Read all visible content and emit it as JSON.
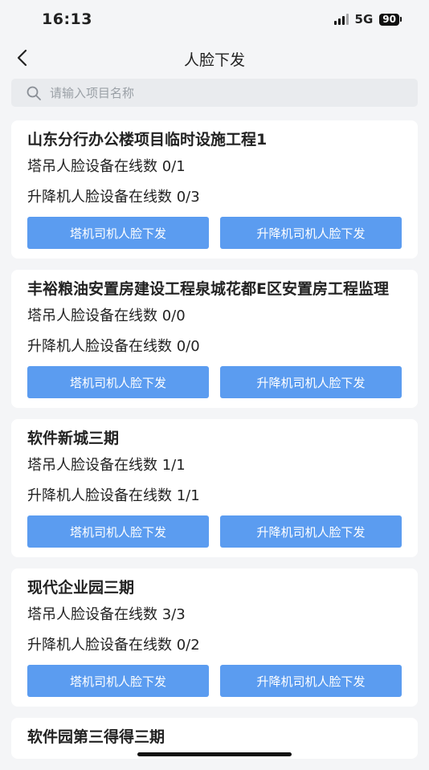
{
  "status_bar": {
    "time": "16:13",
    "network": "5G",
    "battery": "90"
  },
  "nav": {
    "title": "人脸下发",
    "back_icon": "chevron-left-icon"
  },
  "search": {
    "placeholder": "请输入项目名称",
    "value": ""
  },
  "projects": [
    {
      "name": "山东分行办公楼项目临时设施工程1",
      "tower_crane_stat": "塔吊人脸设备在线数 0/1",
      "elevator_stat": "升降机人脸设备在线数 0/3",
      "tower_button": "塔机司机人脸下发",
      "elevator_button": "升降机司机人脸下发"
    },
    {
      "name": "丰裕粮油安置房建设工程泉城花都E区安置房工程监理",
      "tower_crane_stat": "塔吊人脸设备在线数 0/0",
      "elevator_stat": "升降机人脸设备在线数 0/0",
      "tower_button": "塔机司机人脸下发",
      "elevator_button": "升降机司机人脸下发"
    },
    {
      "name": "软件新城三期",
      "tower_crane_stat": "塔吊人脸设备在线数 1/1",
      "elevator_stat": "升降机人脸设备在线数 1/1",
      "tower_button": "塔机司机人脸下发",
      "elevator_button": "升降机司机人脸下发"
    },
    {
      "name": "现代企业园三期",
      "tower_crane_stat": "塔吊人脸设备在线数 3/3",
      "elevator_stat": "升降机人脸设备在线数 0/2",
      "tower_button": "塔机司机人脸下发",
      "elevator_button": "升降机司机人脸下发"
    },
    {
      "name": "软件园第三得得三期",
      "tower_crane_stat": "",
      "elevator_stat": "",
      "tower_button": "",
      "elevator_button": ""
    }
  ]
}
